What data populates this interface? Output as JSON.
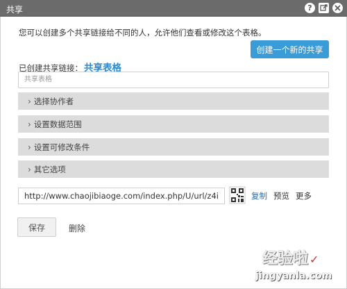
{
  "titlebar": {
    "title": "共享"
  },
  "description": "您可以创建多个共享链接给不同的人，允许他们查看或修改这个表格。",
  "new_share_button": "创建一个新的共享",
  "created_links": {
    "label": "已创建共享链接：",
    "link_name": "共享表格"
  },
  "name_input": {
    "value": "共享表格"
  },
  "sections": [
    {
      "chevron": "›",
      "label": "选择协作者"
    },
    {
      "chevron": "›",
      "label": "设置数据范围"
    },
    {
      "chevron": "›",
      "label": "设置可修改条件"
    },
    {
      "chevron": "›",
      "label": "其它选项"
    }
  ],
  "url_input": {
    "value": "http://www.chaojibiaoge.com/index.php/U/url/z4i"
  },
  "actions": {
    "copy": "复制",
    "preview": "预览",
    "more": "更多"
  },
  "save_button": "保存",
  "delete_link": "删除",
  "watermark": {
    "text": "经验啦",
    "url": "jingyanla.com"
  },
  "colors": {
    "titlebar": "#6b6b6b",
    "primary_button": "#3a9bd9",
    "link": "#2a8ad4",
    "section_bg": "#dcdcdc"
  },
  "icons": {
    "help": "question-icon",
    "popout": "popout-icon",
    "close": "close-icon",
    "qr": "qr-code-icon"
  }
}
